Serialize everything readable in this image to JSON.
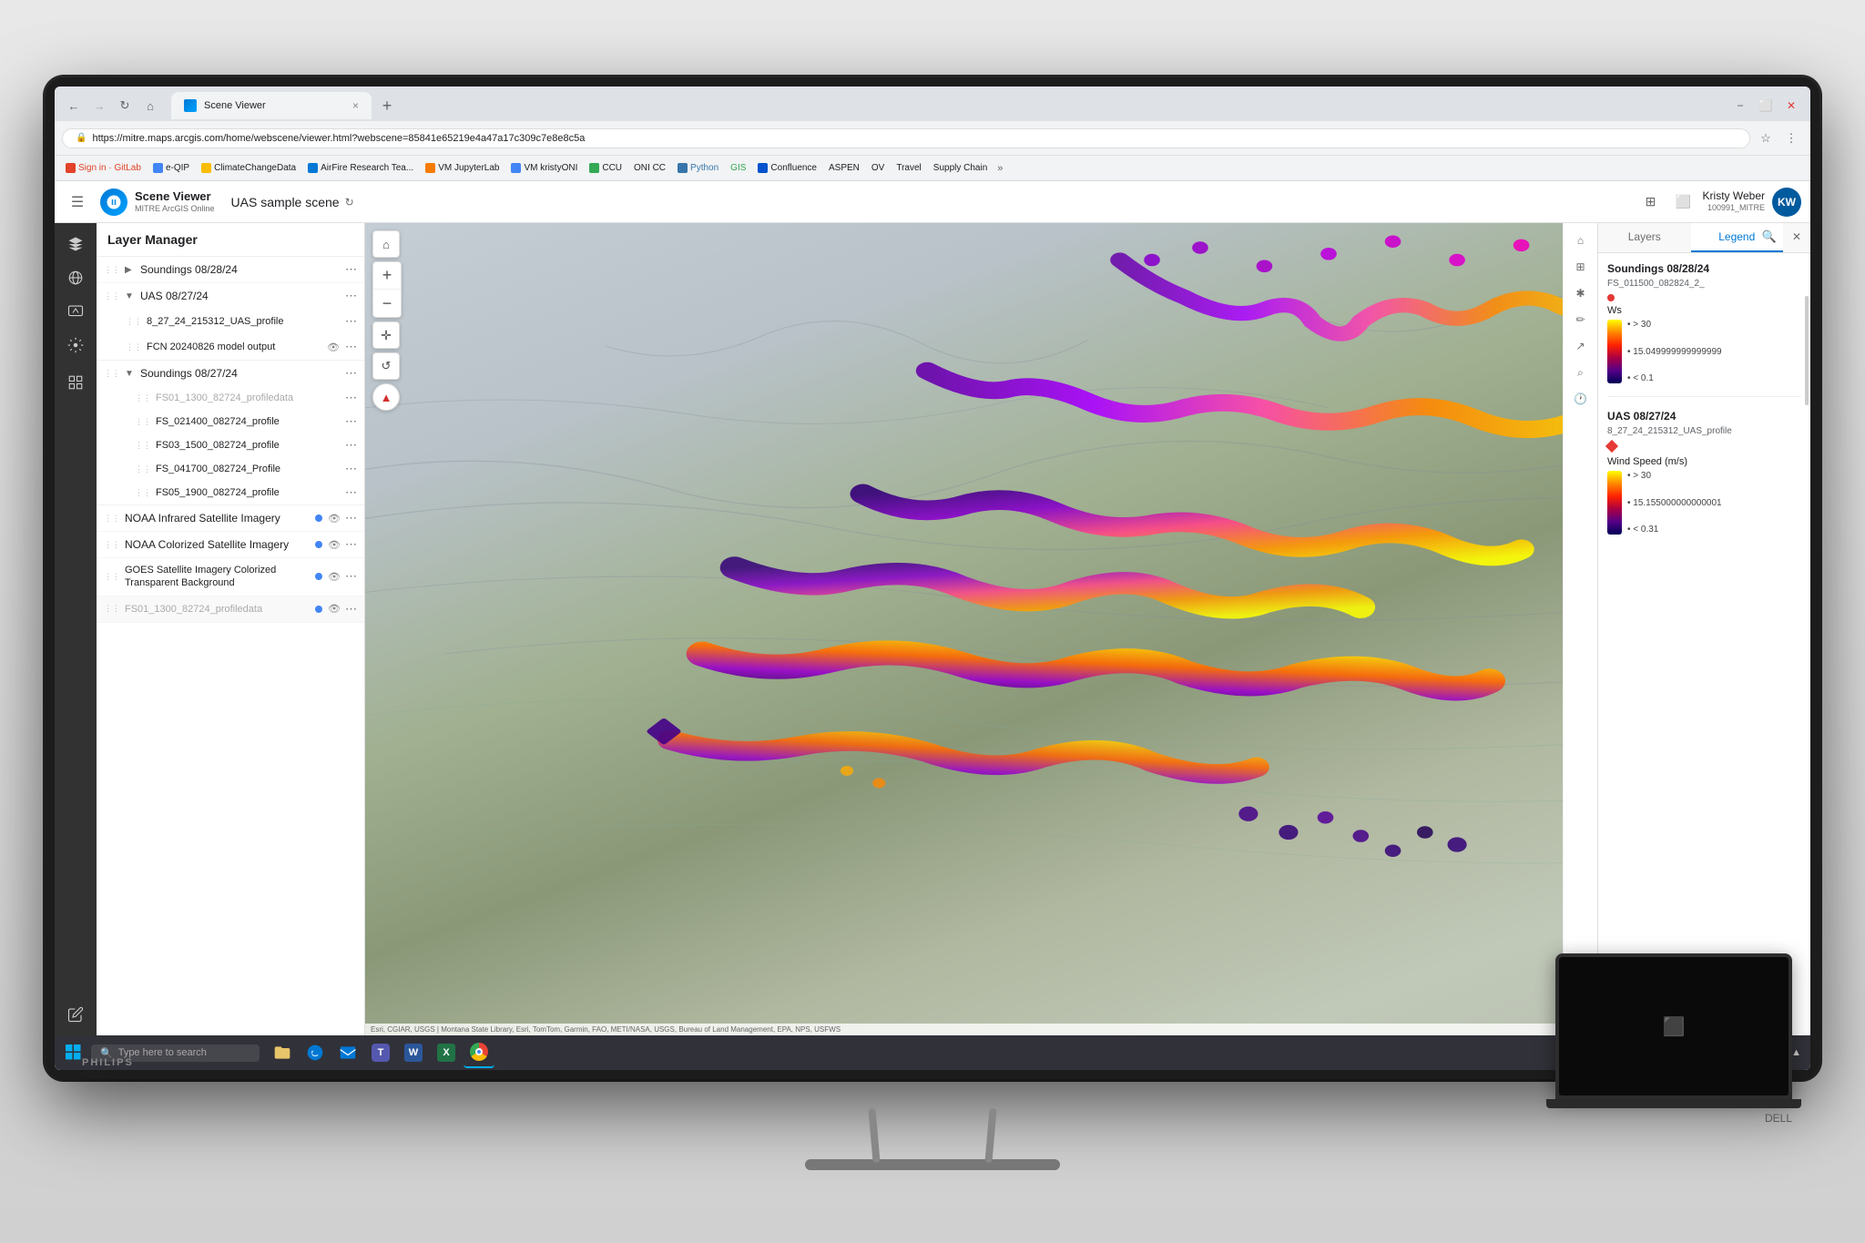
{
  "room": {
    "bg_color": "#d8d8d8"
  },
  "browser": {
    "tab_label": "Scene Viewer",
    "tab_close": "×",
    "new_tab": "+",
    "url": "https://mitre.maps.arcgis.com/home/webscene/viewer.html?webscene=85841e65219e4a47a17c309c7e8e8c5a",
    "nav_back": "←",
    "nav_forward": "→",
    "nav_refresh": "⟳",
    "nav_home": "⌂",
    "bookmarks": [
      {
        "label": "Sign in · GitLab",
        "color": "#e24329"
      },
      {
        "label": "e-QIP",
        "color": "#4285f4"
      },
      {
        "label": "ClimateChangeData",
        "color": "#fbbc04"
      },
      {
        "label": "AirFire Research Tea...",
        "color": "#0078d4"
      },
      {
        "label": "VM JupyterLab",
        "color": "#f57c00"
      },
      {
        "label": "VM kristyONI",
        "color": "#4285f4"
      },
      {
        "label": "CCU",
        "color": "#34a853"
      },
      {
        "label": "ONI CC",
        "color": "#4285f4"
      },
      {
        "label": "Python",
        "color": "#3776ab"
      },
      {
        "label": "GIS",
        "color": "#34a853"
      },
      {
        "label": "Confluence",
        "color": "#0052cc"
      },
      {
        "label": "ASPEN",
        "color": "#ff6600"
      },
      {
        "label": "OV",
        "color": "#4285f4"
      },
      {
        "label": "Travel",
        "color": "#4285f4"
      },
      {
        "label": "Supply Chain",
        "color": "#4285f4"
      }
    ]
  },
  "arcgis": {
    "app_name": "Scene Viewer",
    "app_sub": "MITRE ArcGIS Online",
    "scene_title": "UAS sample scene",
    "menu_icon": "☰",
    "header_icons": [
      "⊞",
      "⬜",
      "✏"
    ],
    "user_initials": "KW",
    "user_name": "Kristy Weber",
    "user_id": "100991_MITRE"
  },
  "layer_panel": {
    "title": "Layer Manager",
    "layers": [
      {
        "name": "Soundings 08/28/24",
        "collapsed": true,
        "indent": 0
      },
      {
        "name": "UAS 08/27/24",
        "collapsed": false,
        "indent": 0
      },
      {
        "name": "8_27_24_215312_UAS_profile",
        "collapsed": false,
        "indent": 1
      },
      {
        "name": "FCN 20240826 model output",
        "collapsed": false,
        "indent": 1,
        "has_eye": true
      },
      {
        "name": "Soundings 08/27/24",
        "collapsed": false,
        "indent": 0
      },
      {
        "name": "FS01_1300_82724_profiledata",
        "collapsed": false,
        "indent": 2,
        "dimmed": true
      },
      {
        "name": "FS_021400_082724_profile",
        "collapsed": false,
        "indent": 2
      },
      {
        "name": "FS03_1500_082724_profile",
        "collapsed": false,
        "indent": 2
      },
      {
        "name": "FS_041700_082724_Profile",
        "collapsed": false,
        "indent": 2
      },
      {
        "name": "FS05_1900_082724_profile",
        "collapsed": false,
        "indent": 2
      },
      {
        "name": "NOAA Infrared Satellite Imagery",
        "collapsed": false,
        "indent": 0,
        "has_dot": true,
        "has_eye": true
      },
      {
        "name": "NOAA Colorized Satellite Imagery",
        "collapsed": false,
        "indent": 0,
        "has_dot": true,
        "has_eye": true
      },
      {
        "name": "GOES Satellite Imagery Colorized Transparent Background",
        "collapsed": false,
        "indent": 0,
        "has_dot": true,
        "has_eye": true
      },
      {
        "name": "FS01_1300_82724_profiledata",
        "collapsed": false,
        "indent": 0,
        "dimmed": true,
        "has_eye": true,
        "partial": true
      }
    ]
  },
  "legend_panel": {
    "tabs": [
      "Layers",
      "Legend"
    ],
    "active_tab": "Legend",
    "sections": [
      {
        "title": "Soundings 08/28/24",
        "sub": "FS_011500_082824_2_",
        "dot_color": "#e53935",
        "dot_shape": "circle"
      },
      {
        "ws_label": "Ws",
        "ws_range_high": "> 30",
        "ws_range_mid": "15.049999999999999",
        "ws_range_low": "< 0.1"
      },
      {
        "title": "UAS 08/27/24",
        "sub": "8_27_24_215312_UAS_profile",
        "dot_color": "#e53935",
        "dot_shape": "diamond"
      },
      {
        "ws_label2": "Wind Speed (m/s)",
        "ws_range_high2": "> 30",
        "ws_range_mid2": "15.155000000000001",
        "ws_range_low2": "< 0.31"
      }
    ]
  },
  "map": {
    "attribution": "Esri, CGIAR, USGS | Montana State Library, Esri, TomTom, Garmin, FAO, METI/NASA, USGS, Bureau of Land Management, EPA, NPS, USFWS"
  },
  "taskbar": {
    "search_placeholder": "Type here to search",
    "time": "▲",
    "windows_icon": "⊞"
  },
  "map_toolbar": {
    "home_btn": "⌂",
    "zoom_in": "+",
    "zoom_out": "−",
    "navigate_btn": "✛",
    "rotate_btn": "↺",
    "compass": "▲"
  }
}
